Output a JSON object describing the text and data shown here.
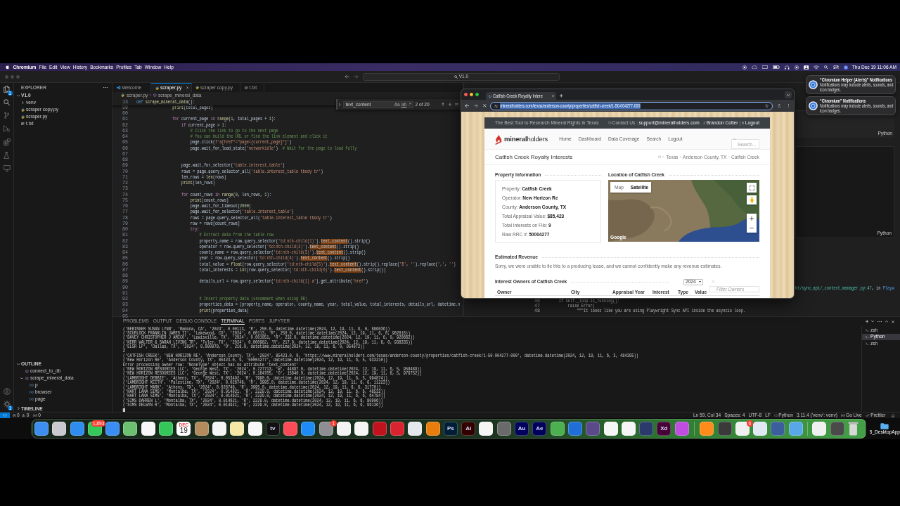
{
  "menu_bar": {
    "app_name": "Chromium",
    "menus": [
      "File",
      "Edit",
      "View",
      "History",
      "Bookmarks",
      "Profiles",
      "Tab",
      "Window",
      "Help"
    ],
    "clock": "Thu Dec 19 11:06 AM"
  },
  "editor_window": {
    "command_center": "V1.0",
    "activity_bar": {
      "explorer_badge": "1",
      "manage_badge": "1"
    },
    "explorer": {
      "title": "EXPLORER",
      "folder": {
        "label": "V1.0",
        "expanded": true,
        "children": [
          {
            "label": "venv",
            "kind": "folder",
            "expanded": false
          },
          {
            "label": "scraper copy.py",
            "kind": "python"
          },
          {
            "label": "scraper.py",
            "kind": "python"
          },
          {
            "label": "t.txt",
            "kind": "text"
          }
        ]
      }
    },
    "outline": {
      "title": "OUTLINE",
      "expanded": true,
      "items": [
        {
          "label": "connect_to_db",
          "kind": "function"
        },
        {
          "label": "scrape_mineral_data",
          "kind": "function",
          "expanded": true,
          "children": [
            {
              "label": "p",
              "kind": "variable"
            },
            {
              "label": "browser",
              "kind": "variable"
            },
            {
              "label": "page",
              "kind": "variable"
            }
          ]
        }
      ]
    },
    "timeline": {
      "title": "TIMELINE",
      "expanded": false
    },
    "editor_tabs": [
      {
        "label": "Welcome",
        "kind": "welcome",
        "selected": false
      },
      {
        "label": "scraper.py",
        "kind": "python",
        "selected": true
      },
      {
        "label": "scraper copy.py",
        "kind": "python",
        "selected": false
      },
      {
        "label": "t.txt",
        "kind": "text",
        "selected": false
      }
    ],
    "breadcrumb": [
      "scraper.py",
      "scrape_mineral_data"
    ],
    "find_widget": {
      "query": "text_content",
      "options": [
        "Aa",
        "ab",
        ".*"
      ],
      "result": "2 of 20"
    },
    "sticky_line": {
      "number": "13",
      "segments": [
        {
          "kind": "declaration",
          "text": "def"
        },
        {
          "kind": "function",
          "text": " scrape_mineral_data"
        },
        {
          "kind": "code",
          "text": "():"
        }
      ]
    },
    "code_lines": [
      {
        "number": "59",
        "segments": [
          {
            "kind": "function",
            "text": "                print"
          },
          {
            "kind": "code",
            "text": "(total_pages)"
          }
        ]
      },
      {
        "number": "60"
      },
      {
        "number": "61",
        "segments": [
          {
            "kind": "keyword",
            "text": "                for"
          },
          {
            "kind": "code",
            "text": " current_page "
          },
          {
            "kind": "keyword",
            "text": "in"
          },
          {
            "kind": "function",
            "text": " range"
          },
          {
            "kind": "code",
            "text": "("
          },
          {
            "kind": "number",
            "text": "1"
          },
          {
            "kind": "code",
            "text": ", total_pages + "
          },
          {
            "kind": "number",
            "text": "1"
          },
          {
            "kind": "code",
            "text": "):"
          }
        ]
      },
      {
        "number": "62",
        "segments": [
          {
            "kind": "keyword",
            "text": "                    if"
          },
          {
            "kind": "code",
            "text": " current_page > "
          },
          {
            "kind": "number",
            "text": "1"
          },
          {
            "kind": "code",
            "text": ":"
          }
        ]
      },
      {
        "number": "63",
        "segments": [
          {
            "kind": "comment",
            "text": "                        # Click the link to go to the next page"
          }
        ]
      },
      {
        "number": "64",
        "segments": [
          {
            "kind": "comment",
            "text": "                        # You can build the URL or find the link element and click it"
          }
        ]
      },
      {
        "number": "65",
        "segments": [
          {
            "kind": "code",
            "text": "                        page.click("
          },
          {
            "kind": "string",
            "text": "f'a[href*=\"page={current_page}\"]'"
          },
          {
            "kind": "code",
            "text": ")"
          }
        ]
      },
      {
        "number": "66",
        "segments": [
          {
            "kind": "code",
            "text": "                        page.wait_for_load_state("
          },
          {
            "kind": "string",
            "text": "'networkidle'"
          },
          {
            "kind": "code",
            "text": ")  "
          },
          {
            "kind": "comment",
            "text": "# Wait for the page to load fully"
          }
        ]
      },
      {
        "number": "67"
      },
      {
        "number": "68"
      },
      {
        "number": "69",
        "segments": [
          {
            "kind": "code",
            "text": "                    page.wait_for_selector("
          },
          {
            "kind": "string",
            "text": "'table.interest_table'"
          },
          {
            "kind": "code",
            "text": ")"
          }
        ]
      },
      {
        "number": "70",
        "segments": [
          {
            "kind": "code",
            "text": "                    rows = page.query_selector_all("
          },
          {
            "kind": "string",
            "text": "'table.interest_table tbody tr'"
          },
          {
            "kind": "code",
            "text": ")"
          }
        ]
      },
      {
        "number": "71",
        "segments": [
          {
            "kind": "code",
            "text": "                    len_rows = "
          },
          {
            "kind": "function",
            "text": "len"
          },
          {
            "kind": "code",
            "text": "(rows)"
          }
        ]
      },
      {
        "number": "72",
        "segments": [
          {
            "kind": "function",
            "text": "                    print"
          },
          {
            "kind": "code",
            "text": "(len_rows)"
          }
        ]
      },
      {
        "number": "73"
      },
      {
        "number": "74",
        "segments": [
          {
            "kind": "keyword",
            "text": "                    for"
          },
          {
            "kind": "code",
            "text": " count_rows "
          },
          {
            "kind": "keyword",
            "text": "in"
          },
          {
            "kind": "function",
            "text": " range"
          },
          {
            "kind": "code",
            "text": "("
          },
          {
            "kind": "number",
            "text": "0"
          },
          {
            "kind": "code",
            "text": ", len_rows, "
          },
          {
            "kind": "number",
            "text": "1"
          },
          {
            "kind": "code",
            "text": "):"
          }
        ]
      },
      {
        "number": "75",
        "segments": [
          {
            "kind": "function",
            "text": "                        print"
          },
          {
            "kind": "code",
            "text": "(count_rows)"
          }
        ]
      },
      {
        "number": "76",
        "segments": [
          {
            "kind": "code",
            "text": "                        page.wait_for_timeout("
          },
          {
            "kind": "number",
            "text": "2000"
          },
          {
            "kind": "code",
            "text": ")"
          }
        ]
      },
      {
        "number": "77",
        "segments": [
          {
            "kind": "code",
            "text": "                        page.wait_for_selector("
          },
          {
            "kind": "string",
            "text": "'table.interest_table'"
          },
          {
            "kind": "code",
            "text": ")"
          }
        ]
      },
      {
        "number": "78",
        "segments": [
          {
            "kind": "code",
            "text": "                        rows = page.query_selector_all("
          },
          {
            "kind": "string",
            "text": "'table.interest_table tbody tr'"
          },
          {
            "kind": "code",
            "text": ")"
          }
        ]
      },
      {
        "number": "79",
        "segments": [
          {
            "kind": "code",
            "text": "                        row = rows[count_rows]"
          }
        ]
      },
      {
        "number": "80",
        "segments": [
          {
            "kind": "keyword",
            "text": "                        try"
          },
          {
            "kind": "code",
            "text": ":"
          }
        ]
      },
      {
        "number": "81",
        "segments": [
          {
            "kind": "comment",
            "text": "                            # Extract data from the table row"
          }
        ]
      },
      {
        "number": "82",
        "segments": [
          {
            "kind": "code",
            "text": "                            property_name = row.query_selector("
          },
          {
            "kind": "string",
            "text": "'td:nth-child(1)'"
          },
          {
            "kind": "code",
            "text": ")."
          },
          {
            "kind": "match",
            "text": "text_content"
          },
          {
            "kind": "code",
            "text": "().strip()"
          }
        ]
      },
      {
        "number": "83",
        "segments": [
          {
            "kind": "code",
            "text": "                            operator = row.query_selector("
          },
          {
            "kind": "string",
            "text": "'td:nth-child(2)'"
          },
          {
            "kind": "code",
            "text": ")."
          },
          {
            "kind": "match",
            "text": "text_content"
          },
          {
            "kind": "code",
            "text": "().strip()"
          }
        ]
      },
      {
        "number": "84",
        "segments": [
          {
            "kind": "code",
            "text": "                            county_name = row.query_selector("
          },
          {
            "kind": "string",
            "text": "'td:nth-child(3)'"
          },
          {
            "kind": "code",
            "text": ")."
          },
          {
            "kind": "match",
            "text": "text_content"
          },
          {
            "kind": "code",
            "text": "().strip()"
          }
        ]
      },
      {
        "number": "85",
        "segments": [
          {
            "kind": "code",
            "text": "                            year = row.query_selector("
          },
          {
            "kind": "string",
            "text": "'td:nth-child(4)'"
          },
          {
            "kind": "code",
            "text": ")."
          },
          {
            "kind": "match",
            "text": "text_content"
          },
          {
            "kind": "code",
            "text": "().strip()"
          }
        ]
      },
      {
        "number": "86",
        "segments": [
          {
            "kind": "code",
            "text": "                            total_value = "
          },
          {
            "kind": "function",
            "text": "float"
          },
          {
            "kind": "code",
            "text": "(row.query_selector("
          },
          {
            "kind": "string",
            "text": "'td:nth-child(5)'"
          },
          {
            "kind": "code",
            "text": ")."
          },
          {
            "kind": "match",
            "text": "text_content"
          },
          {
            "kind": "code",
            "text": "().strip().replace("
          },
          {
            "kind": "string",
            "text": "'$'"
          },
          {
            "kind": "code",
            "text": ", "
          },
          {
            "kind": "string",
            "text": "''"
          },
          {
            "kind": "code",
            "text": ").replace("
          },
          {
            "kind": "string",
            "text": "','"
          },
          {
            "kind": "code",
            "text": ", "
          },
          {
            "kind": "string",
            "text": "''"
          },
          {
            "kind": "code",
            "text": ")"
          }
        ]
      },
      {
        "number": "87",
        "segments": [
          {
            "kind": "code",
            "text": "                            total_interests = "
          },
          {
            "kind": "function",
            "text": "int"
          },
          {
            "kind": "code",
            "text": "(row.query_selector("
          },
          {
            "kind": "string",
            "text": "'td:nth-child(6)'"
          },
          {
            "kind": "code",
            "text": ")."
          },
          {
            "kind": "match",
            "text": "text_content"
          },
          {
            "kind": "code",
            "text": "().strip())"
          }
        ]
      },
      {
        "number": "88"
      },
      {
        "number": "89",
        "segments": [
          {
            "kind": "code",
            "text": "                            details_url = row.query_selector("
          },
          {
            "kind": "string",
            "text": "'td:nth-child(1) a'"
          },
          {
            "kind": "code",
            "text": ").get_attribute("
          },
          {
            "kind": "string",
            "text": "'href'"
          },
          {
            "kind": "code",
            "text": ")"
          }
        ]
      },
      {
        "number": "90"
      },
      {
        "number": "91"
      },
      {
        "number": "92",
        "segments": [
          {
            "kind": "comment",
            "text": "                            # Insert property data (uncomment when using DB)"
          }
        ]
      },
      {
        "number": "93",
        "segments": [
          {
            "kind": "code",
            "text": "                            properties_data = (property_name, operator, county_name, year, total_value, total_interests, details_url, datetime.n"
          }
        ]
      },
      {
        "number": "94",
        "segments": [
          {
            "kind": "function",
            "text": "                            print"
          },
          {
            "kind": "code",
            "text": "(properties_data)"
          }
        ]
      },
      {
        "number": "95"
      }
    ],
    "notebook": {
      "cells": [
        {
          "language": "Python"
        },
        {
          "language": "Python"
        }
      ],
      "error_location": [
        {
          "kind": "path",
          "text": "ht/sync_api/_context_manager.py:47"
        },
        {
          "kind": "code",
          "text": ", in "
        },
        {
          "kind": "name",
          "text": "Playw"
        }
      ],
      "traceback": [
        {
          "number": "46",
          "text": "    if self._loop.is_running():"
        },
        {
          "number": "47",
          "text": "        raise Error("
        },
        {
          "number": "48",
          "text": "            \"\"\"It looks like you are using Playwright Sync API inside the asyncio loop."
        }
      ]
    },
    "panel": {
      "tabs": [
        {
          "label": "PROBLEMS",
          "selected": false
        },
        {
          "label": "OUTPUT",
          "selected": false
        },
        {
          "label": "DEBUG CONSOLE",
          "selected": false
        },
        {
          "label": "TERMINAL",
          "selected": true
        },
        {
          "label": "PORTS",
          "selected": false
        },
        {
          "label": "JUPYTER",
          "selected": false
        }
      ],
      "terminal_lines": [
        "('BEBINGER SUSAN LYNN', 'Ramona, CA', '2024', 0.00113, 'R', 250.0, datetime.datetime(2024, 12, 19, 11, 6, 0, 886036))",
        "('SCURLOCK FRANKLIN JAMES II', 'Lakewood, CO', '2024', 0.00113, 'R', 250.0, datetime.datetime(2024, 12, 19, 11, 6, 0, 902818))",
        "('DAVEY CHRISTOPHER J AMICO', 'Lewisville, TX', '2024', 0.001051, 'R', 232.0, datetime.datetime(2024, 12, 19, 11, 6, 0, 920662))",
        "('KERR WALTER & SARAH LIVING TR', 'Tyler, TX', '2024', 0.000982, 'R', 217.0, datetime.datetime(2024, 12, 19, 11, 6, 0, 938335))",
        "('ELSR LP', 'Dallas, TX', '2024', 0.000978, 'O', 216.0, datetime.datetime(2024, 12, 19, 11, 6, 0, 954972))",
        "2",
        "('CATFISH CREEK', 'NEW HORIZON RE', 'Anderson County, TX', '2024', 85423.0, 9, 'https://www.mineralholders.com/texas/anderson-county/properties/catfish-creek/1-50-004277-000', datetime.datetime(2024, 12, 19, 11, 6, 3, 484395))",
        "('New Horizon Re', 'Anderson County, TX', 85423.0, 9, '50004277', datetime.datetime(2024, 12, 19, 11, 6, 5, 933210))",
        "Error processing owner row: 'NoneType' object has no attribute 'text_content'",
        "('NEW HORIZON RESOURCES LLC', 'George West, TX', '2024', 0.727713, 'W', 44887.0, datetime.datetime(2024, 12, 19, 11, 6, 5, 958489))",
        "('NEW HORIZON RESOURCES LLC', 'George West, TX', '2024', 0.184705, 'O', 15640.0, datetime.datetime(2024, 12, 19, 11, 6, 5, 976752))",
        "('LAMBRIGHT DEBBIE', 'Athens, TX', '2024', 0.053492, 'R', 7990.0, datetime.datetime(2024, 12, 19, 11, 6, 5, 994874))",
        "('LAMBRIGHT KEITH', 'Palestine, TX', '2024', 0.026746, 'R', 3995.0, datetime.datetime(2024, 12, 19, 11, 6, 6, 11223))",
        "('LAMBRIGHT MARK', 'Athens, TX', '2024', 0.026746, 'R', 3995.0, datetime.datetime(2024, 12, 19, 11, 6, 6, 31770))",
        "('HART LANA SIMS', 'Montalba, TX', '2024', 0.014921, 'R', 2229.0, datetime.datetime(2024, 12, 19, 11, 6, 6, 48532))",
        "('HART LANA SIMS', 'Montalba, TX', '2024', 0.014921, 'R', 2229.0, datetime.datetime(2024, 12, 19, 11, 6, 6, 64784))",
        "('SIMS DARREN L', 'Montalba, TX', '2024', 0.014921, 'R', 2229.0, datetime.datetime(2024, 12, 19, 11, 6, 6, 80906))",
        "('SIMS DELWYN R', 'Montalba, TX', '2024', 0.014921, 'R', 2229.0, datetime.datetime(2024, 12, 19, 11, 6, 6, 99136))"
      ],
      "terminals": [
        {
          "label": "zsh",
          "selected": false
        },
        {
          "label": "Python",
          "selected": true
        },
        {
          "label": "zsh",
          "selected": false
        }
      ]
    },
    "status_bar": {
      "errors": "0",
      "warnings": "0",
      "ports": "0",
      "items": [
        {
          "kind": "text",
          "text": "Ln 59, Col 34"
        },
        {
          "kind": "text",
          "text": "Spaces: 4"
        },
        {
          "kind": "text",
          "text": "UTF-8"
        },
        {
          "kind": "text",
          "text": "LF"
        },
        {
          "kind": "language",
          "text": "Python"
        },
        {
          "kind": "text",
          "text": "3.11.4 ('venv': venv)"
        },
        {
          "kind": "live",
          "text": "Go Live"
        },
        {
          "kind": "formatter",
          "text": "Prettier"
        }
      ]
    }
  },
  "browser": {
    "tab_title": "Catfish Creek Royalty Intere",
    "loading": true,
    "url": "mineralholders.com/texas/anderson-county/properties/catfish-creek/1-50-004277-000",
    "url_selected": true,
    "page": {
      "tagline": "The Best Tool to Research Mineral Rights in Texas",
      "contact_label": "Contact Us :",
      "contact_email": "support@mineralholders.com",
      "user": "Brandon Cotter",
      "separator": "|",
      "logout": "Logout",
      "logo": "**mineral**holders",
      "nav": [
        "Home",
        "Dashboard",
        "Data Coverage",
        "Search",
        "Logout"
      ],
      "search_placeholder": "Search...",
      "title": "Catfish Creek Royalty Interests",
      "breadcrumb": [
        "Texas",
        "Anderson County, TX",
        "Catfish Creek"
      ],
      "property_info": {
        "heading": "Property Information",
        "rows": [
          {
            "label": "Property:",
            "value": "Catfish Creek"
          },
          {
            "label": "Operator:",
            "value": "New Horizon Re"
          },
          {
            "label": "County:",
            "value": "Anderson County, TX"
          },
          {
            "label": "Total Appraisal Value:",
            "value": "$85,423"
          },
          {
            "label": "Total Interests on File:",
            "value": "9"
          },
          {
            "label": "Raw RRC #:",
            "value": "50004277"
          }
        ]
      },
      "location": {
        "heading": "Location of Catfish Creek",
        "map_types": [
          {
            "label": "Map",
            "selected": false
          },
          {
            "label": "Satellite",
            "selected": true
          }
        ],
        "logo": "Google"
      },
      "revenue": {
        "heading": "Estimated Revenue",
        "text": "Sorry, we were unable to tie this to a producing lease, and we cannot confidently make any revenue estimates."
      },
      "owners": {
        "heading": "Interest Owners of Catfish Creek",
        "year": "2024",
        "filter_placeholder": "Filter Owners",
        "columns": [
          "Owner",
          "City",
          "Appraisal Year",
          "Interest",
          "Type",
          "Value"
        ]
      }
    }
  },
  "notifications": [
    {
      "title": "“Chromium Helper (Alerts)” Notifications",
      "body": "Notifications may include alerts, sounds, and icon badges."
    },
    {
      "title": "“Chromium” Notifications",
      "body": "Notifications may include alerts, sounds, and icon badges."
    }
  ],
  "dock": {
    "apps": [
      {
        "kind": "app",
        "color": "#3d8ef0"
      },
      {
        "kind": "app",
        "color": "#c9c9cf"
      },
      {
        "kind": "app",
        "color": "#2f8df0"
      },
      {
        "kind": "app",
        "color": "#34c759",
        "badge": "1,893"
      },
      {
        "kind": "app",
        "color": "#3a8df2"
      },
      {
        "kind": "app",
        "color": "#6cc070"
      },
      {
        "kind": "app",
        "color": "#f7f7f7"
      },
      {
        "kind": "app",
        "color": "#34c759"
      },
      {
        "kind": "calendar",
        "month": "DEC",
        "day": "19"
      },
      {
        "kind": "app",
        "color": "#b38b5d"
      },
      {
        "kind": "app",
        "color": "#f5f5f5"
      },
      {
        "kind": "app",
        "color": "#f6e7a6"
      },
      {
        "kind": "app",
        "color": "#f7f7f7"
      },
      {
        "kind": "app",
        "color": "#111111",
        "glyph": "tv"
      },
      {
        "kind": "app",
        "color": "#f94c57"
      },
      {
        "kind": "app",
        "color": "#1e8cf4"
      },
      {
        "kind": "app",
        "color": "#8e8e93",
        "badge": "1"
      },
      {
        "kind": "app",
        "color": "#f3f3f3"
      },
      {
        "kind": "app",
        "color": "#f5f5f5"
      },
      {
        "kind": "app",
        "color": "#c1121f"
      },
      {
        "kind": "app",
        "color": "#d9232e"
      },
      {
        "kind": "app",
        "color": "#e5e8ec"
      },
      {
        "kind": "app",
        "color": "#e87d0d"
      },
      {
        "kind": "app",
        "color": "#001e36",
        "glyph": "Ps"
      },
      {
        "kind": "app",
        "color": "#330000",
        "glyph": "Ai"
      },
      {
        "kind": "app",
        "color": "#f5f5f5"
      },
      {
        "kind": "app",
        "color": "#6a6a6a"
      },
      {
        "kind": "app",
        "color": "#00005b",
        "glyph": "Au"
      },
      {
        "kind": "app",
        "color": "#00005b",
        "glyph": "Ae"
      },
      {
        "kind": "app",
        "color": "#4caf50"
      },
      {
        "kind": "app",
        "color": "#1f6fd6"
      },
      {
        "kind": "app",
        "color": "#5b4a8a"
      },
      {
        "kind": "app",
        "color": "#f5f5f5"
      },
      {
        "kind": "app",
        "color": "#f5f5f5"
      },
      {
        "kind": "app",
        "color": "#2a3a6a"
      },
      {
        "kind": "app",
        "color": "#470137",
        "glyph": "Xd"
      },
      {
        "kind": "app",
        "color": "#c04de0"
      }
    ],
    "pinned": [
      {
        "kind": "app",
        "color": "#ff8c1a"
      },
      {
        "kind": "app",
        "color": "#3a3a3a"
      },
      {
        "kind": "app",
        "color": "#f0f0f0",
        "badge": "6"
      },
      {
        "kind": "app",
        "color": "#dfe8f3"
      },
      {
        "kind": "app",
        "color": "#3a5f9a"
      },
      {
        "kind": "app",
        "color": "#5aa7e8"
      }
    ],
    "recent": [
      {
        "kind": "app",
        "color": "#f0f0f0"
      },
      {
        "kind": "app",
        "color": "#4a4a4a"
      }
    ]
  },
  "desktop_items": [
    {
      "label": "5_DesktopApp"
    }
  ]
}
